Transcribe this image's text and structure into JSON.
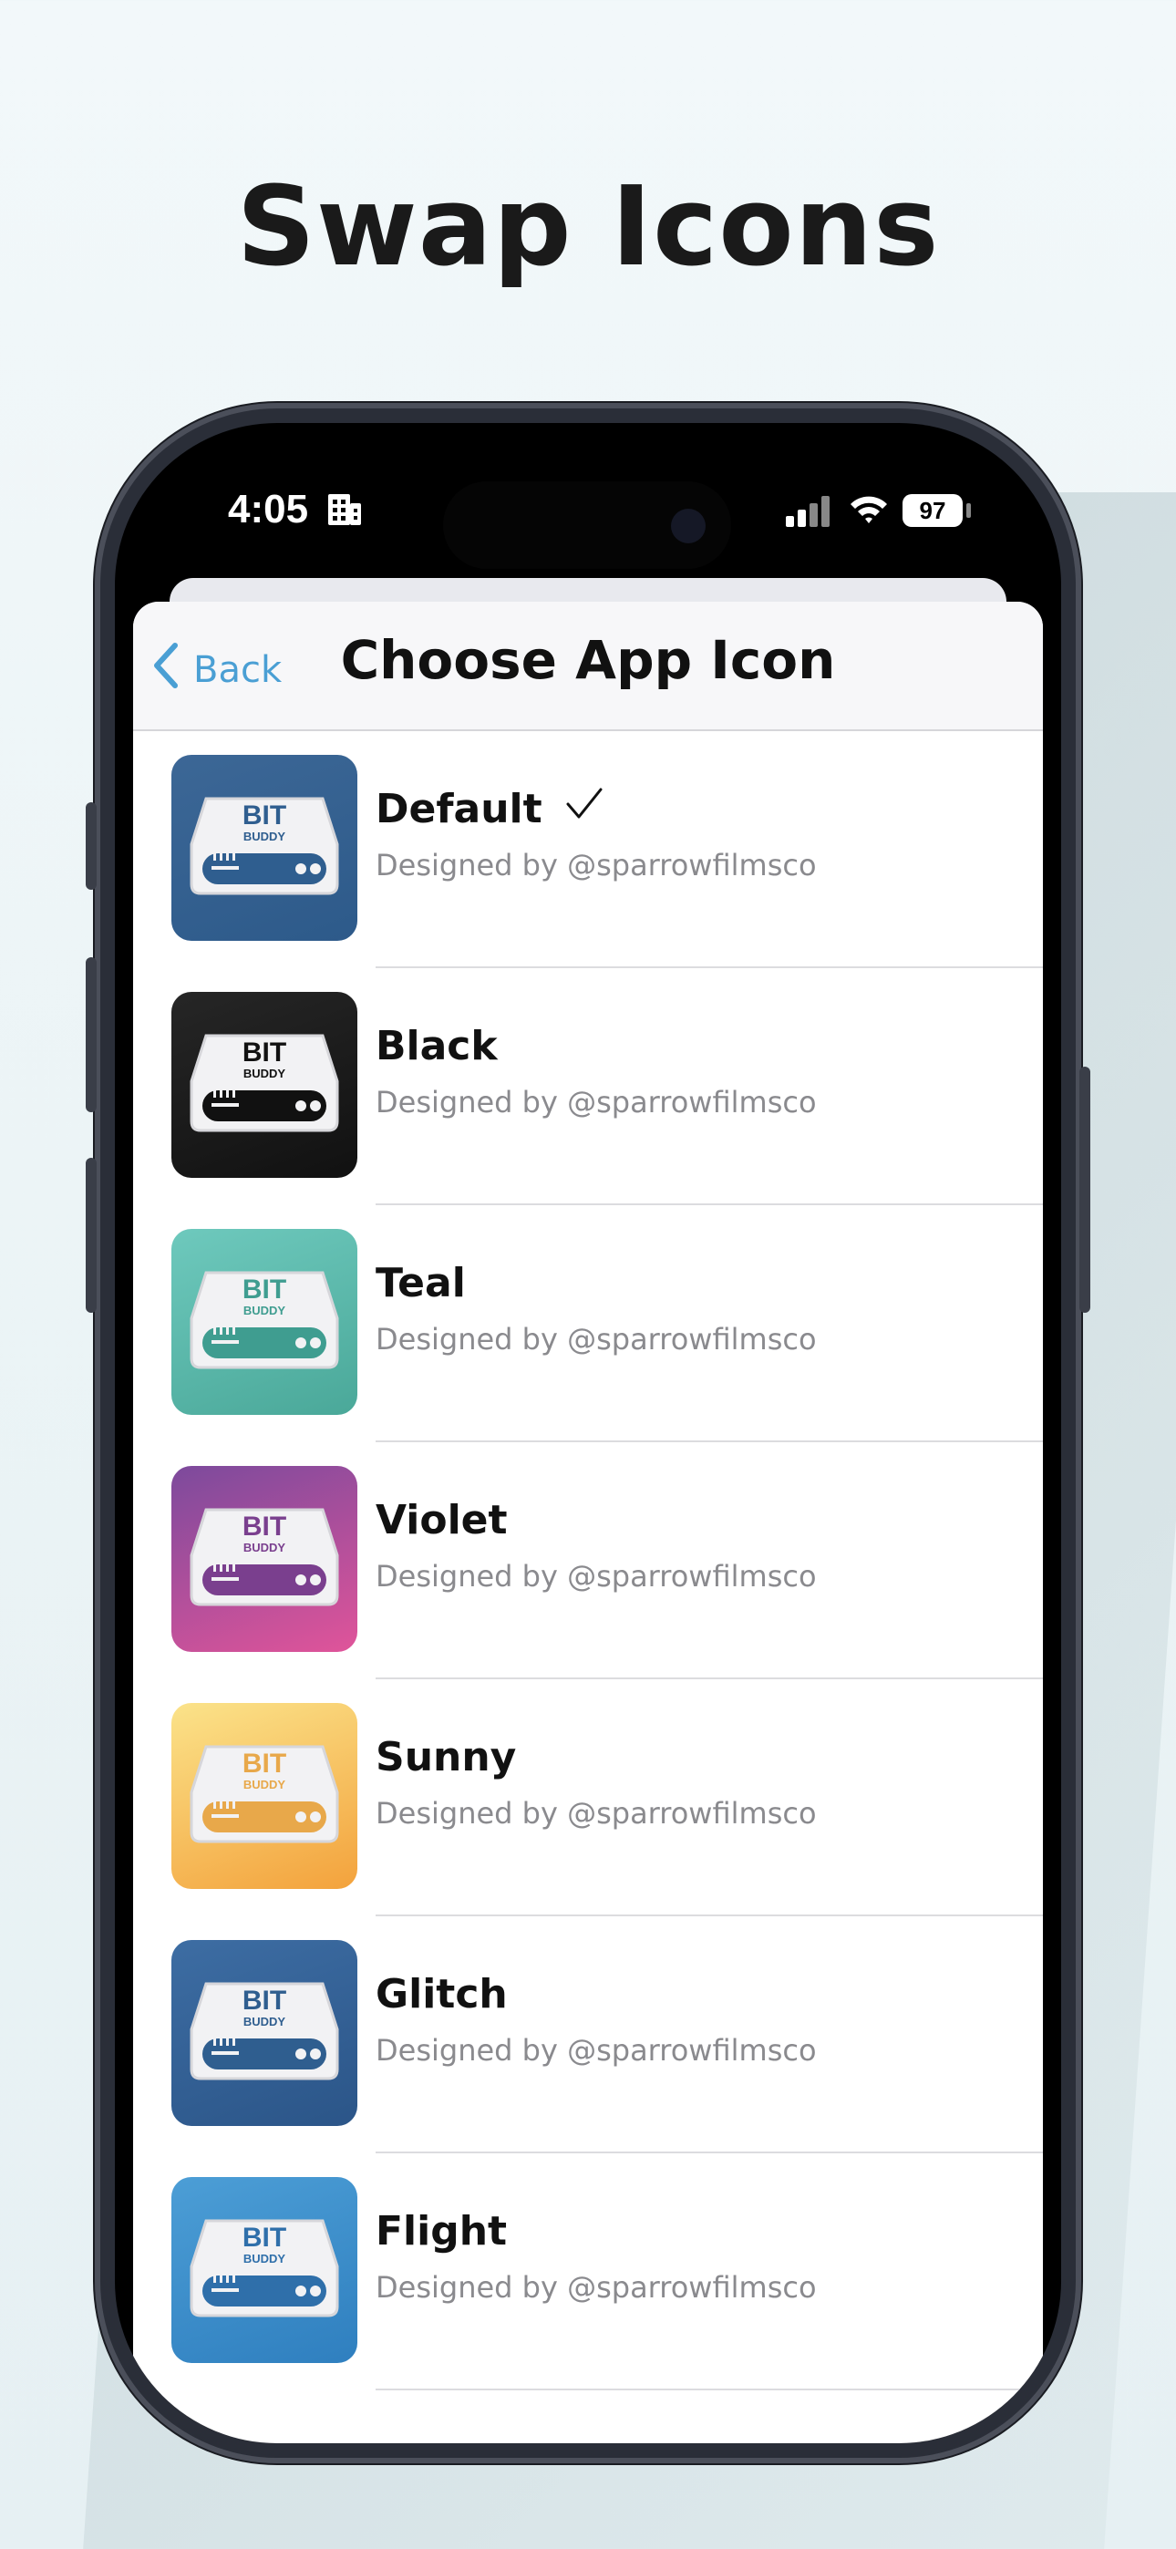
{
  "headline": "Swap Icons",
  "status_bar": {
    "time": "4:05",
    "battery": "97"
  },
  "navbar": {
    "back_label": "Back",
    "title": "Choose App Icon"
  },
  "icon_label": {
    "bit": "BIT",
    "buddy": "BUDDY"
  },
  "icons": [
    {
      "name": "Default",
      "designer": "Designed by @sparrowfilmsco",
      "selected": true,
      "bg1": "#3c6796",
      "bg2": "#2d5a8a",
      "accent": "#2f5e8f"
    },
    {
      "name": "Black",
      "designer": "Designed by @sparrowfilmsco",
      "selected": false,
      "bg1": "#262626",
      "bg2": "#111111",
      "accent": "#111111"
    },
    {
      "name": "Teal",
      "designer": "Designed by @sparrowfilmsco",
      "selected": false,
      "bg1": "#6ec9bd",
      "bg2": "#4aa899",
      "accent": "#3f9d90"
    },
    {
      "name": "Violet",
      "designer": "Designed by @sparrowfilmsco",
      "selected": false,
      "bg1": "#7c4a9c",
      "bg2": "#e0549a",
      "accent": "#7a3f8e"
    },
    {
      "name": "Sunny",
      "designer": "Designed by @sparrowfilmsco",
      "selected": false,
      "bg1": "#fbe38a",
      "bg2": "#f3a23c",
      "accent": "#e8a84a"
    },
    {
      "name": "Glitch",
      "designer": "Designed by @sparrowfilmsco",
      "selected": false,
      "bg1": "#3d6da3",
      "bg2": "#2b5588",
      "accent": "#2f5e8f"
    },
    {
      "name": "Flight",
      "designer": "Designed by @sparrowfilmsco",
      "selected": false,
      "bg1": "#4c9ed6",
      "bg2": "#2f7fbf",
      "accent": "#2f6faa"
    }
  ]
}
